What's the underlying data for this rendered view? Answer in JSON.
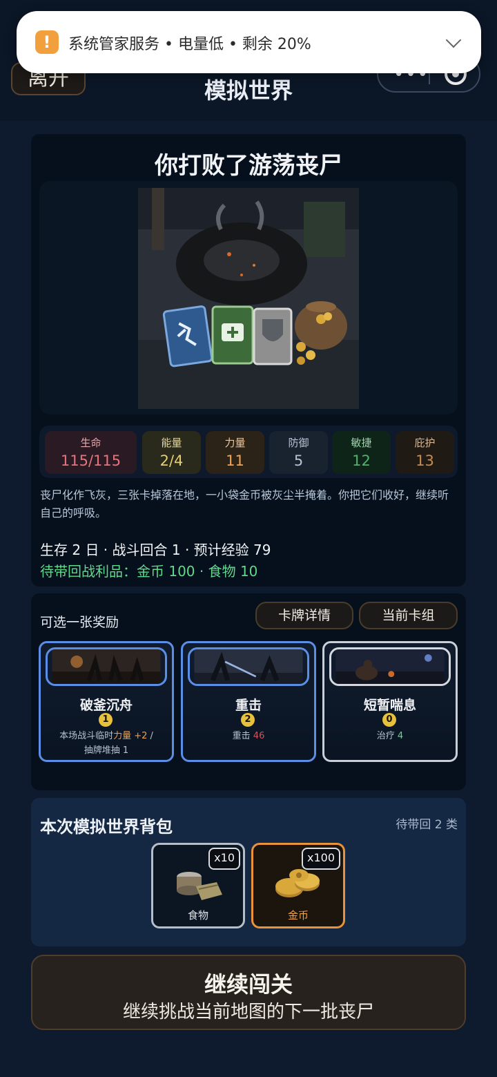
{
  "notification": {
    "text": "系统管家服务 • 电量低 • 剩余 20%",
    "icon": "battery-alert-icon"
  },
  "header": {
    "leave_label": "离开",
    "title": "模拟世界"
  },
  "result": {
    "title": "你打败了游荡丧尸",
    "stats": [
      {
        "label": "生命",
        "value": "115/115"
      },
      {
        "label": "能量",
        "value": "2/4"
      },
      {
        "label": "力量",
        "value": "11"
      },
      {
        "label": "防御",
        "value": "5"
      },
      {
        "label": "敏捷",
        "value": "12"
      },
      {
        "label": "庇护",
        "value": "13"
      }
    ],
    "description": "丧尸化作飞灰，三张卡掉落在地，一小袋金币被灰尘半掩着。你把它们收好，继续听自己的呼吸。",
    "progress": "生存 2 日 · 战斗回合 1 · 预计经验 79",
    "loot": "待带回战利品：金币 100 · 食物 10"
  },
  "reward": {
    "label": "可选一张奖励",
    "detail_button": "卡牌详情",
    "deck_button": "当前卡组",
    "cards": [
      {
        "name": "破釜沉舟",
        "cost": "1",
        "desc_a": "本场战斗临时",
        "desc_b": "力量",
        "desc_c": "+2",
        "desc_d": " /",
        "desc_e": "抽牌堆抽 1"
      },
      {
        "name": "重击",
        "cost": "2",
        "desc_a": "重击 ",
        "desc_b": "46"
      },
      {
        "name": "短暂喘息",
        "cost": "0",
        "desc_a": "治疗 ",
        "desc_b": "4"
      }
    ]
  },
  "bag": {
    "title": "本次模拟世界背包",
    "count": "待带回 2 类",
    "items": [
      {
        "name": "食物",
        "qty": "x10"
      },
      {
        "name": "金币",
        "qty": "x100"
      }
    ]
  },
  "continue": {
    "title": "继续闯关",
    "subtitle": "继续挑战当前地图的下一批丧尸"
  },
  "colors": {
    "background": "#0e1b2e",
    "panel": "#05101c",
    "card_border": "#5b8fe6",
    "loot": "#5fd98a",
    "gold": "#e8923a"
  }
}
